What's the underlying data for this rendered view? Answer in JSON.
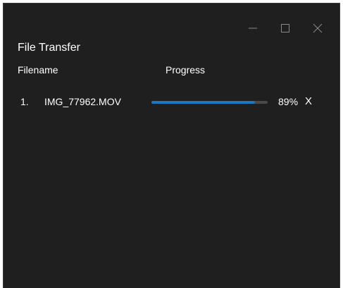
{
  "window": {
    "title": "File Transfer",
    "controls": {
      "minimize_icon": "minimize-icon",
      "maximize_icon": "maximize-icon",
      "close_icon": "close-icon"
    }
  },
  "columns": {
    "filename": "Filename",
    "progress": "Progress"
  },
  "transfers": [
    {
      "index": "1.",
      "filename": "IMG_77962.MOV",
      "progress": 0.89,
      "percent_label": "89%",
      "cancel_label": "X"
    }
  ],
  "colors": {
    "window_bg": "#1f1f1f",
    "text": "#ffffff",
    "progress_fill": "#1a78c2",
    "progress_track": "#4a4a4a",
    "control_glyph": "#8a8a8a"
  }
}
